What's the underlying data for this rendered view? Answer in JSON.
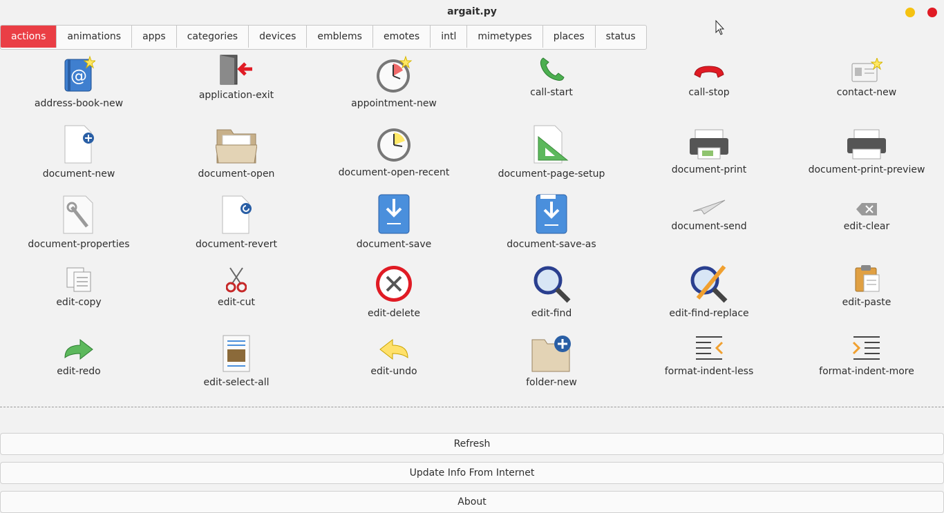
{
  "window": {
    "title": "argait.py"
  },
  "tabs": [
    {
      "label": "actions",
      "active": true
    },
    {
      "label": "animations"
    },
    {
      "label": "apps"
    },
    {
      "label": "categories"
    },
    {
      "label": "devices"
    },
    {
      "label": "emblems"
    },
    {
      "label": "emotes"
    },
    {
      "label": "intl"
    },
    {
      "label": "mimetypes"
    },
    {
      "label": "places"
    },
    {
      "label": "status"
    }
  ],
  "icons": [
    {
      "name": "address-book-new",
      "label": "address-book-new"
    },
    {
      "name": "application-exit",
      "label": "application-exit"
    },
    {
      "name": "appointment-new",
      "label": "appointment-new"
    },
    {
      "name": "call-start",
      "label": "call-start"
    },
    {
      "name": "call-stop",
      "label": "call-stop"
    },
    {
      "name": "contact-new",
      "label": "contact-new"
    },
    {
      "name": "document-new",
      "label": "document-new"
    },
    {
      "name": "document-open",
      "label": "document-open"
    },
    {
      "name": "document-open-recent",
      "label": "document-open-recent"
    },
    {
      "name": "document-page-setup",
      "label": "document-page-setup"
    },
    {
      "name": "document-print",
      "label": "document-print"
    },
    {
      "name": "document-print-preview",
      "label": "document-print-preview"
    },
    {
      "name": "document-properties",
      "label": "document-properties"
    },
    {
      "name": "document-revert",
      "label": "document-revert"
    },
    {
      "name": "document-save",
      "label": "document-save"
    },
    {
      "name": "document-save-as",
      "label": "document-save-as"
    },
    {
      "name": "document-send",
      "label": "document-send"
    },
    {
      "name": "edit-clear",
      "label": "edit-clear"
    },
    {
      "name": "edit-copy",
      "label": "edit-copy"
    },
    {
      "name": "edit-cut",
      "label": "edit-cut"
    },
    {
      "name": "edit-delete",
      "label": "edit-delete"
    },
    {
      "name": "edit-find",
      "label": "edit-find"
    },
    {
      "name": "edit-find-replace",
      "label": "edit-find-replace"
    },
    {
      "name": "edit-paste",
      "label": "edit-paste"
    },
    {
      "name": "edit-redo",
      "label": "edit-redo"
    },
    {
      "name": "edit-select-all",
      "label": "edit-select-all"
    },
    {
      "name": "edit-undo",
      "label": "edit-undo"
    },
    {
      "name": "folder-new",
      "label": "folder-new"
    },
    {
      "name": "format-indent-less",
      "label": "format-indent-less"
    },
    {
      "name": "format-indent-more",
      "label": "format-indent-more"
    }
  ],
  "buttons": {
    "refresh": "Refresh",
    "update": "Update Info From Internet",
    "about": "About"
  },
  "colors": {
    "accent": "#ea3e45",
    "minimize": "#f5c211",
    "close": "#e01b24"
  }
}
